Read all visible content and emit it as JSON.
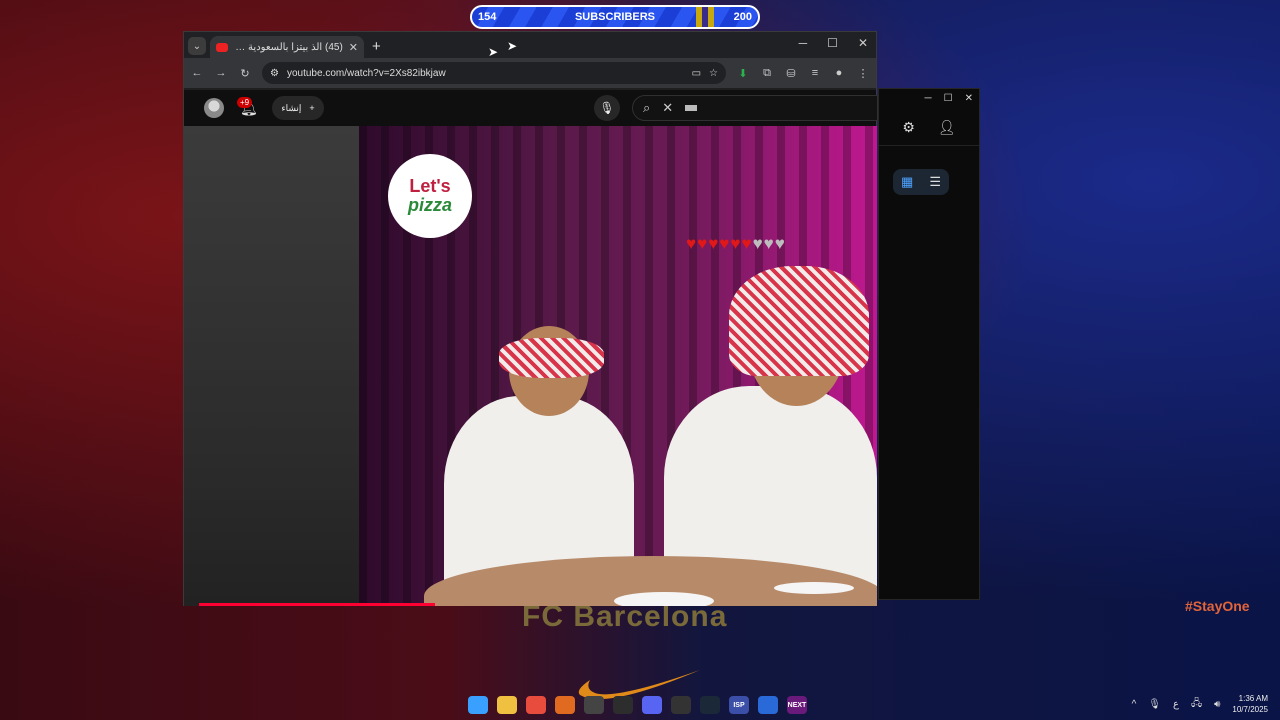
{
  "subscriber_bar": {
    "current": "154",
    "label": "SUBSCRIBERS",
    "goal": "200"
  },
  "browser": {
    "tab_title": "(45) الذ بيتزا بالسعودية 🍕😋 الـ",
    "new_tab": "+",
    "tab_close": "✕",
    "url": "youtube.com/watch?v=2Xs82ibkjaw",
    "window_controls": {
      "minimize": "─",
      "maximize": "☐",
      "close": "✕"
    }
  },
  "youtube": {
    "notification_count": "+9",
    "create_label": "إنشاء",
    "search_clear": "✕"
  },
  "video": {
    "logo_line1": "Let's",
    "logo_line2": "pizza",
    "hearts_full": 6,
    "hearts_empty": 3,
    "progress_fraction": 0.34
  },
  "side_window": {
    "controls": {
      "minimize": "─",
      "maximize": "☐",
      "close": "✕"
    }
  },
  "desktop": {
    "wallpaper_text": "FC Barcelona",
    "hashtag": "#StayOne"
  },
  "taskbar": {
    "apps": [
      {
        "name": "windows-start-icon",
        "color": "#3aa0ff",
        "label": ""
      },
      {
        "name": "file-explorer-icon",
        "color": "#f0c040",
        "label": ""
      },
      {
        "name": "chrome-icon",
        "color": "#e84c3d",
        "label": ""
      },
      {
        "name": "artifact-app-icon",
        "color": "#e06a20",
        "label": ""
      },
      {
        "name": "obs-icon",
        "color": "#444444",
        "label": ""
      },
      {
        "name": "terminal-icon",
        "color": "#2d2d2d",
        "label": ""
      },
      {
        "name": "discord-icon",
        "color": "#5865f2",
        "label": ""
      },
      {
        "name": "github-icon",
        "color": "#333333",
        "label": ""
      },
      {
        "name": "steam-icon",
        "color": "#1b2838",
        "label": ""
      },
      {
        "name": "isp-app-icon",
        "color": "#3b4ea8",
        "label": "ISP"
      },
      {
        "name": "cc-app-icon",
        "color": "#2a6ad8",
        "label": ""
      },
      {
        "name": "next-app-icon",
        "color": "#6a1a7a",
        "label": "NEXT"
      }
    ],
    "input_lang": "ع",
    "time": "1:36 AM",
    "date": "10/7/2025"
  }
}
